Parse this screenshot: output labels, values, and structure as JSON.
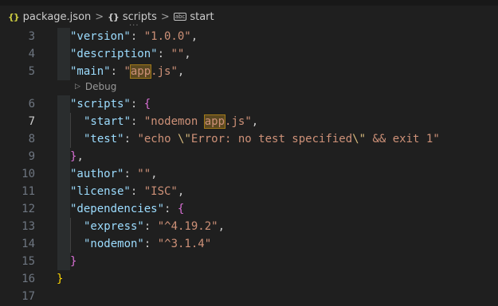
{
  "breadcrumb": {
    "file_icon": "{}",
    "file": "package.json",
    "obj_icon": "{}",
    "scripts": "scripts",
    "sym_icon": "abc",
    "start": "start",
    "separator": ">"
  },
  "codelens": {
    "label": "Debug",
    "icon": "play-icon"
  },
  "lines": {
    "l3": {
      "num": "3",
      "key": "\"version\"",
      "colon": ": ",
      "val": "\"1.0.0\"",
      "tail": ","
    },
    "l4": {
      "num": "4",
      "key": "\"description\"",
      "colon": ": ",
      "val": "\"\"",
      "tail": ","
    },
    "l5": {
      "num": "5",
      "key": "\"main\"",
      "colon": ": ",
      "val_a": "\"",
      "val_hl": "app",
      "val_b": ".js\"",
      "tail": ","
    },
    "l6": {
      "num": "6",
      "key": "\"scripts\"",
      "colon": ": ",
      "brace": "{"
    },
    "l7": {
      "num": "7",
      "key": "\"start\"",
      "colon": ": ",
      "val_a": "\"nodemon ",
      "val_hl": "app",
      "val_b": ".js\"",
      "tail": ","
    },
    "l8": {
      "num": "8",
      "key": "\"test\"",
      "colon": ": ",
      "val_a": "\"echo ",
      "esc1": "\\\"",
      "val_mid": "Error: no test specified",
      "esc2": "\\\"",
      "val_b": " && exit 1\""
    },
    "l9": {
      "num": "9",
      "brace": "}",
      "tail": ","
    },
    "l10": {
      "num": "10",
      "key": "\"author\"",
      "colon": ": ",
      "val": "\"\"",
      "tail": ","
    },
    "l11": {
      "num": "11",
      "key": "\"license\"",
      "colon": ": ",
      "val": "\"ISC\"",
      "tail": ","
    },
    "l12": {
      "num": "12",
      "key": "\"dependencies\"",
      "colon": ": ",
      "brace": "{"
    },
    "l13": {
      "num": "13",
      "key": "\"express\"",
      "colon": ": ",
      "val": "\"^4.19.2\"",
      "tail": ","
    },
    "l14": {
      "num": "14",
      "key": "\"nodemon\"",
      "colon": ": ",
      "val": "\"^3.1.4\""
    },
    "l15": {
      "num": "15",
      "brace": "}"
    },
    "l16": {
      "num": "16",
      "brace": "}"
    },
    "l17": {
      "num": "17"
    }
  }
}
